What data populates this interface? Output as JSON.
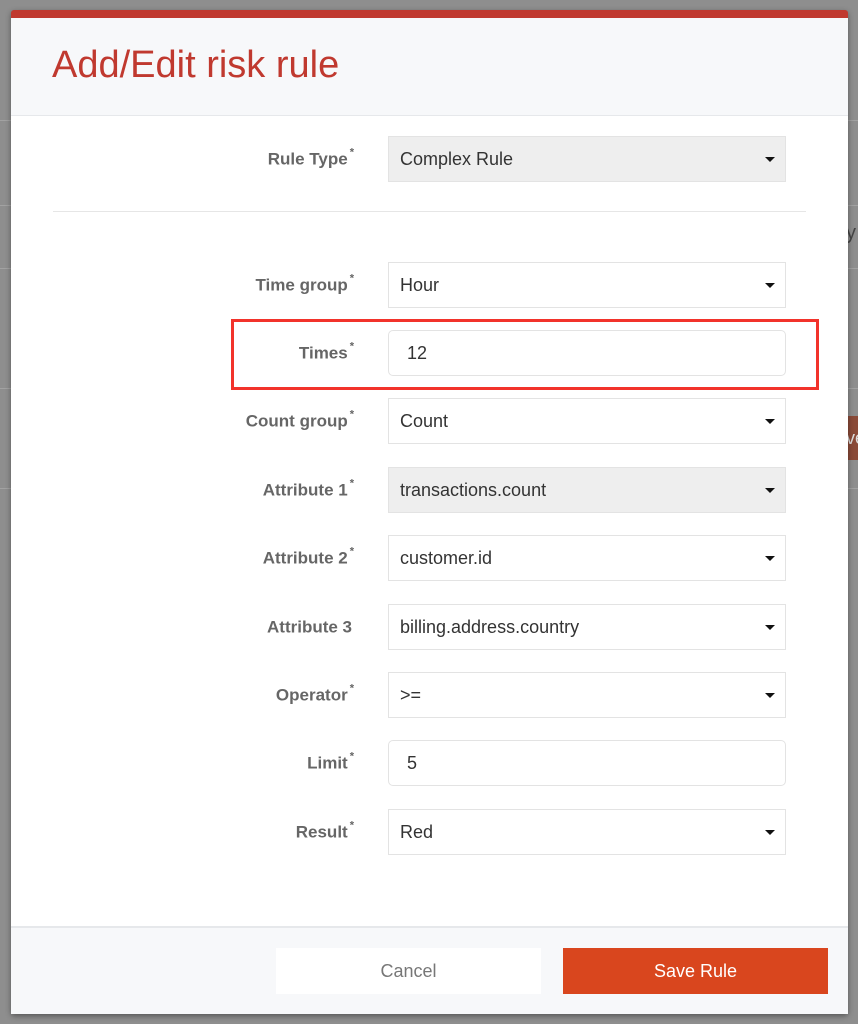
{
  "modal": {
    "title": "Add/Edit risk rule"
  },
  "background": {
    "peek_text": "y",
    "peek_button": "ve"
  },
  "rule_type": {
    "label": "Rule Type",
    "required": "*",
    "value": "Complex Rule"
  },
  "fields": [
    {
      "label": "Time group",
      "required": "*",
      "value": "Hour",
      "kind": "select"
    },
    {
      "label": "Times",
      "required": "*",
      "value": "12",
      "kind": "input"
    },
    {
      "label": "Count group",
      "required": "*",
      "value": "Count",
      "kind": "select"
    },
    {
      "label": "Attribute 1",
      "required": "*",
      "value": "transactions.count",
      "kind": "select-disabled"
    },
    {
      "label": "Attribute 2",
      "required": "*",
      "value": "customer.id",
      "kind": "select"
    },
    {
      "label": "Attribute 3",
      "required": "",
      "value": "billing.address.country",
      "kind": "select"
    },
    {
      "label": "Operator",
      "required": "*",
      "value": ">=",
      "kind": "select"
    },
    {
      "label": "Limit",
      "required": "*",
      "value": "5",
      "kind": "input"
    },
    {
      "label": "Result",
      "required": "*",
      "value": "Red",
      "kind": "select"
    }
  ],
  "footer": {
    "cancel_label": "Cancel",
    "save_label": "Save Rule"
  },
  "colors": {
    "accent": "#c0392f",
    "save": "#d9461e",
    "highlight": "#f2332b"
  }
}
